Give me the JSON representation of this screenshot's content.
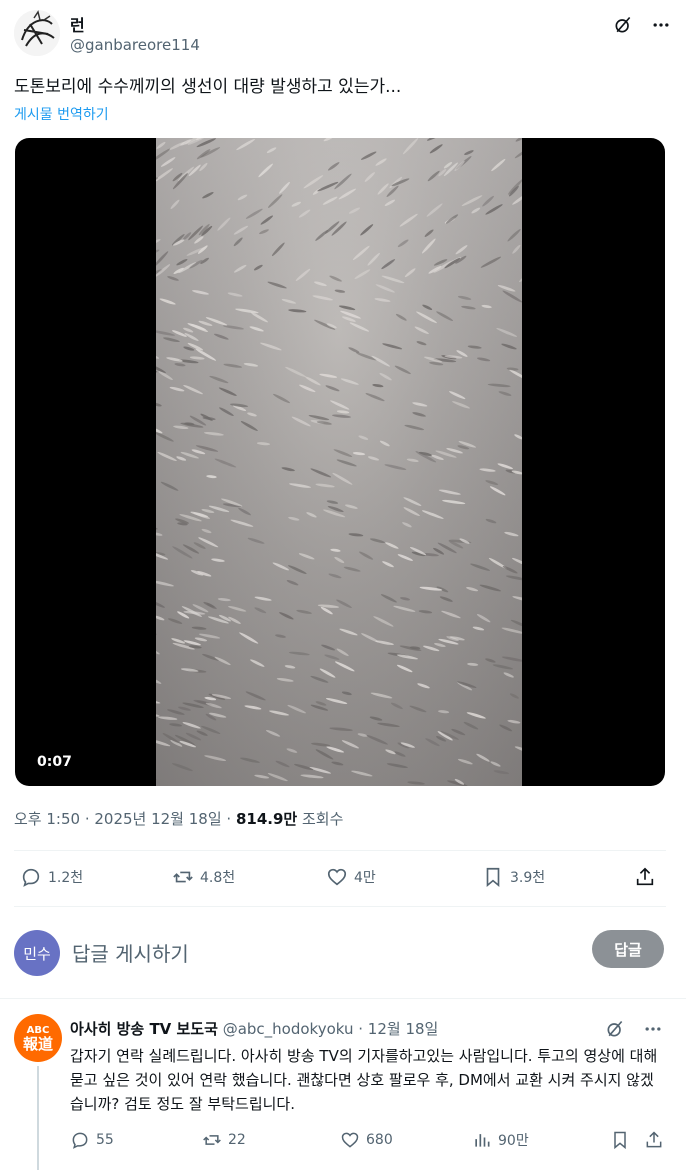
{
  "post": {
    "author_name": "런",
    "author_handle": "@ganbareore114",
    "text": "도톤보리에 수수께끼의 생선이 대량 발생하고 있는가...",
    "translate_label": "게시물 번역하기",
    "video_time": "0:07",
    "timestamp": "오후 1:50 · 2025년 12월 18일 · ",
    "views_count": "814.9만",
    "views_label": " 조회수"
  },
  "engagement": {
    "replies": "1.2천",
    "reposts": "4.8천",
    "likes": "4만",
    "bookmarks": "3.9천"
  },
  "reply_compose": {
    "avatar_text": "민수",
    "placeholder": "답글 게시하기",
    "button_label": "답글"
  },
  "reply_tweet": {
    "avatar_top": "ABC",
    "avatar_bottom": "報道",
    "name": "아사히 방송 TV 보도국",
    "handle": "@abc_hodokyoku",
    "separator": " · ",
    "date": "12월 18일",
    "text": "갑자기 연락 실례드립니다. 아사히 방송 TV의 기자를하고있는 사람입니다. 투고의 영상에 대해 묻고 싶은 것이 있어 연락 했습니다. 괜찮다면 상호 팔로우 후, DM에서 교환 시켜 주시지 않겠습니까? 검토 정도 잘 부탁드립니다.",
    "replies": "55",
    "reposts": "22",
    "likes": "680",
    "views": "90만"
  },
  "icons": {
    "grok": "grok-icon",
    "more": "more-icon",
    "reply": "reply-icon",
    "repost": "repost-icon",
    "like": "heart-icon",
    "bookmark": "bookmark-icon",
    "share": "share-icon",
    "views": "views-icon"
  },
  "colors": {
    "link": "#1d9bf0",
    "muted": "#536471",
    "reply_button": "#8c9196",
    "reply_avatar": "#6872c4",
    "abc_orange": "#ff6a00"
  }
}
